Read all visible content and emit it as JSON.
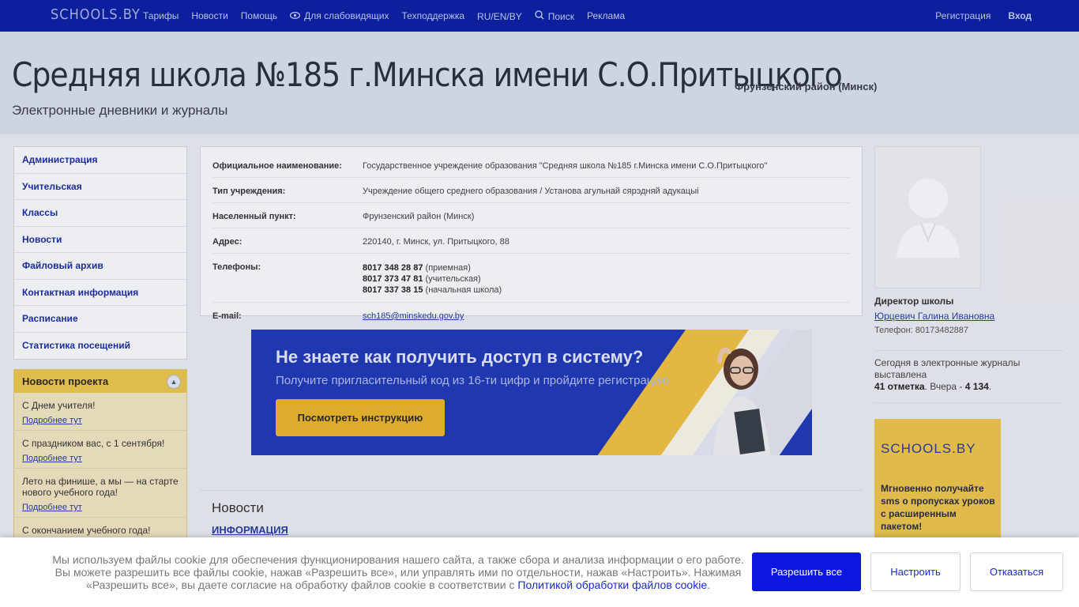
{
  "topbar": {
    "logo": "SCHOOLS.BY",
    "nav": [
      "Тарифы",
      "Новости",
      "Помощь",
      "Для слабовидящих",
      "Техподдержка",
      "RU/EN/BY",
      "Поиск",
      "Реклама"
    ],
    "register": "Регистрация",
    "login": "Вход"
  },
  "header": {
    "title": "Средняя школа №185 г.Минска имени С.О.Притыцкого",
    "district": "Фрунзенский район (Минск)",
    "subtitle": "Электронные дневники и журналы"
  },
  "sidebar": {
    "items": [
      "Администрация",
      "Учительская",
      "Классы",
      "Новости",
      "Файловый архив",
      "Контактная информация",
      "Расписание",
      "Статистика посещений"
    ]
  },
  "project_news": {
    "title": "Новости проекта",
    "items": [
      {
        "text": "С Днем учителя!",
        "link": "Подробнее тут"
      },
      {
        "text": "С праздником вас, с 1 сентября!",
        "link": "Подробнее тут"
      },
      {
        "text": "Лето на финише, а мы — на старте нового учебного года!",
        "link": "Подробнее тут"
      },
      {
        "text": "С окончанием учебного года!",
        "link": ""
      }
    ]
  },
  "info": {
    "official_label": "Официальное наименование:",
    "official": "Государственное учреждение образования \"Средняя школа №185 г.Минска имени С.О.Притыцкого\"",
    "type_label": "Тип учреждения:",
    "type": "Учреждение общего среднего образования / Установа агульнай сярэдняй адукацыі",
    "locality_label": "Населенный пункт:",
    "locality": "Фрунзенский район (Минск)",
    "address_label": "Адрес:",
    "address": "220140, г. Минск, ул. Притыцкого, 88",
    "phones_label": "Телефоны:",
    "phones": [
      {
        "number": "8017 348 28 87",
        "note": "(приемная)"
      },
      {
        "number": "8017 373 47 81",
        "note": "(учительская)"
      },
      {
        "number": "8017 337 38 15",
        "note": "(начальная школа)"
      }
    ],
    "email_label": "E-mail:",
    "email": "sch185@minskedu.gov.by"
  },
  "banner": {
    "title": "Не знаете как получить доступ в систему?",
    "subtitle": "Получите пригласительный код из 16-ти цифр и пройдите регистрацию",
    "button": "Посмотреть инструкцию"
  },
  "news": {
    "title": "Новости",
    "first": "ИНФОРМАЦИЯ"
  },
  "director": {
    "label": "Директор школы",
    "name": "Юрцевич Галина Ивановна",
    "phone": "Телефон: 80173482887"
  },
  "stats": {
    "line1": "Сегодня в электронные журналы выставлена",
    "today": "41 отметка",
    "mid": ". Вчера - ",
    "yesterday": "4 134",
    "end": "."
  },
  "ad": {
    "logo": "SCHOOLS.BY",
    "text": "Мгновенно получайте sms о пропусках уроков с расширенным пакетом!"
  },
  "cookie": {
    "text": "Мы используем файлы cookie для обеспечения функционирования нашего сайта, а также сбора и анализа информации о его работе. Вы можете разрешить все файлы cookie, нажав «Разрешить все», или управлять ими по отдельности, нажав «Настроить». Нажимая «Разрешить все», вы даете согласие на обработку файлов cookie в соответствии с ",
    "policy": "Политикой обработки файлов cookie",
    "end": ".",
    "allow": "Разрешить все",
    "setup": "Настроить",
    "decline": "Отказаться"
  }
}
